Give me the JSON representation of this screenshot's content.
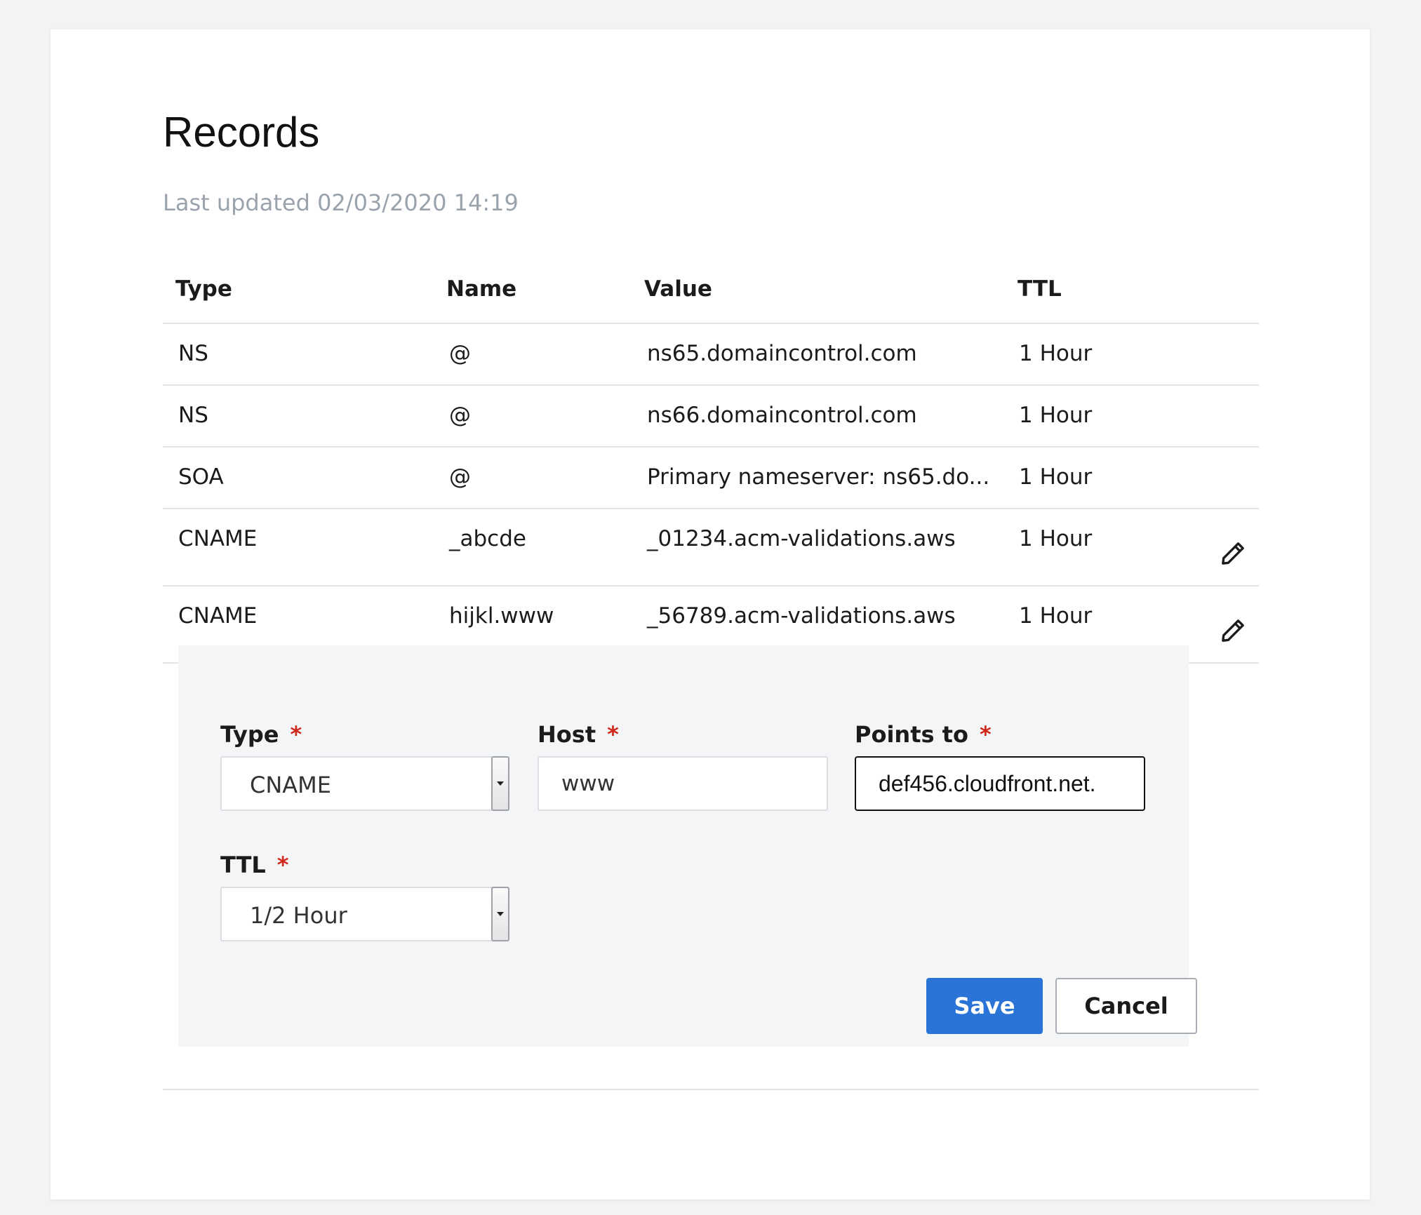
{
  "page": {
    "title": "Records",
    "last_updated": "Last updated 02/03/2020 14:19"
  },
  "table": {
    "headers": {
      "type": "Type",
      "name": "Name",
      "value": "Value",
      "ttl": "TTL"
    },
    "rows": [
      {
        "type": "NS",
        "name": "@",
        "value": "ns65.domaincontrol.com",
        "ttl": "1 Hour",
        "editable": false
      },
      {
        "type": "NS",
        "name": "@",
        "value": "ns66.domaincontrol.com",
        "ttl": "1 Hour",
        "editable": false
      },
      {
        "type": "SOA",
        "name": "@",
        "value": "Primary nameserver: ns65.do...",
        "ttl": "1 Hour",
        "editable": false
      },
      {
        "type": "CNAME",
        "name": "_abcde",
        "value": "_01234.acm-validations.aws",
        "ttl": "1 Hour",
        "editable": true
      },
      {
        "type": "CNAME",
        "name": "hijkl.www",
        "value": "_56789.acm-validations.aws",
        "ttl": "1 Hour",
        "editable": true
      }
    ]
  },
  "form": {
    "type_label": "Type",
    "type_value": "CNAME",
    "host_label": "Host",
    "host_value": "www",
    "points_to_label": "Points to",
    "points_to_value": "def456.cloudfront.net.",
    "ttl_label": "TTL",
    "ttl_value": "1/2 Hour",
    "required_mark": "*",
    "save_label": "Save",
    "cancel_label": "Cancel"
  },
  "icons": {
    "edit": "pencil-icon"
  },
  "colors": {
    "accent": "#2a74d7",
    "required": "#d0281b",
    "muted_text": "#9aa3ad",
    "panel_bg": "#f4f5f7"
  }
}
